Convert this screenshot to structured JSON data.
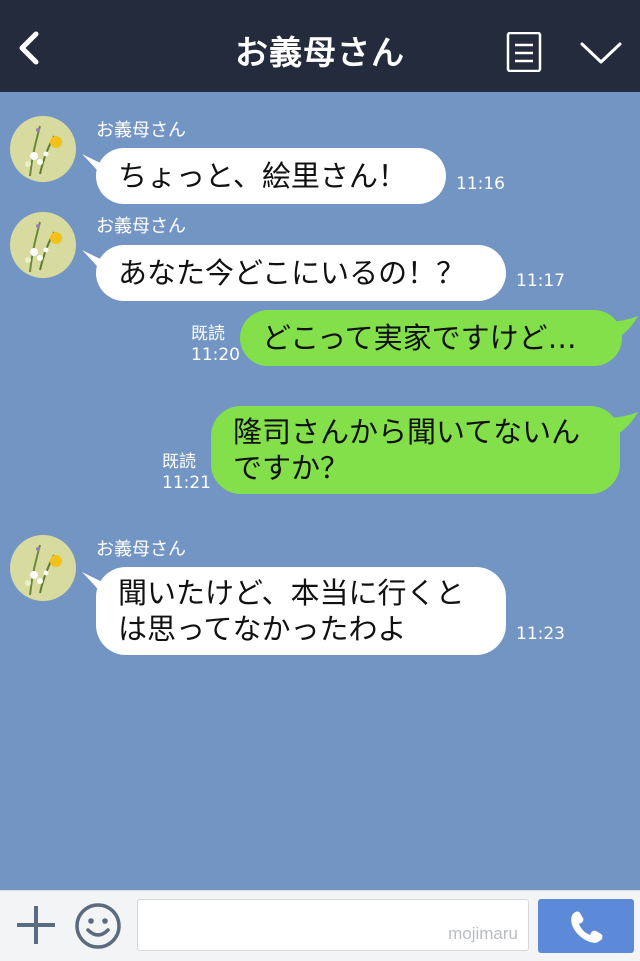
{
  "header": {
    "title": "お義母さん",
    "back_icon": "chevron-left-icon",
    "menu_icon": "document-menu-icon",
    "expand_icon": "chevron-down-icon"
  },
  "messages": [
    {
      "side": "left",
      "sender": "お義母さん",
      "lines": [
        "ちょっと、絵里さん！"
      ],
      "time": "11:16"
    },
    {
      "side": "left",
      "sender": "お義母さん",
      "lines": [
        "あなた今どこにいるの！？"
      ],
      "time": "11:17"
    },
    {
      "side": "right",
      "lines": [
        "どこって実家ですけど…"
      ],
      "read": "既読",
      "time": "11:20"
    },
    {
      "side": "right",
      "lines": [
        "隆司さんから聞いてないん",
        "ですか？"
      ],
      "read": "既読",
      "time": "11:21"
    },
    {
      "side": "left",
      "sender": "お義母さん",
      "lines": [
        "聞いたけど、本当に行くと",
        "は思ってなかったわよ"
      ],
      "time": "11:23"
    }
  ],
  "footer": {
    "plus_icon": "plus-icon",
    "emoji_icon": "smiley-icon",
    "input_value": "",
    "watermark": "mojimaru",
    "call_icon": "phone-icon"
  },
  "colors": {
    "header_bg": "#232b3d",
    "chat_bg": "#7395c3",
    "incoming_bubble": "#ffffff",
    "outgoing_bubble": "#84e04a",
    "call_button": "#5c89d8"
  }
}
